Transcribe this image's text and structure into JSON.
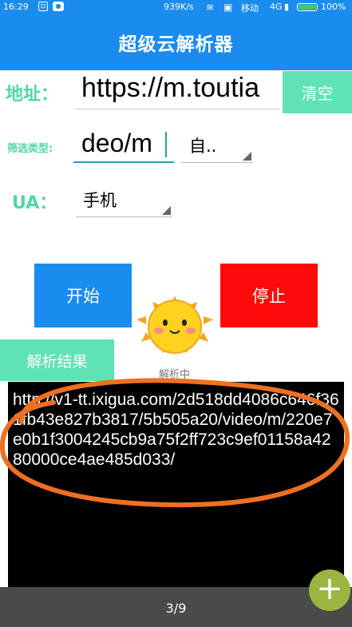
{
  "status_bar": {
    "time": "16:29",
    "net_speed": "939K/s",
    "carrier": "移动",
    "network": "4G",
    "battery": "100%",
    "battery_level": 1.0
  },
  "app": {
    "title": "超级云解析器"
  },
  "form": {
    "address_label": "地址：",
    "url_value": "https://m.toutia",
    "clear_label": "清空",
    "filter_label": "筛选类型:",
    "filter_value": "deo/m",
    "filter_select": "自..",
    "ua_label": "UA：",
    "ua_select": "手机"
  },
  "actions": {
    "start_label": "开始",
    "stop_label": "停止",
    "status_text": "解析中",
    "result_label": "解析结果"
  },
  "result": {
    "text": "http://v1-tt.ixigua.com/2d518dd4086c646f361fb43e827b3817/5b505a20/video/m/220e7e0b1f3004245cb9a75f2ff723c9ef01158a4280000ce4ae485d033/",
    "page_indicator": "3/9"
  },
  "fab": {
    "icon": "plus-icon",
    "label": "+"
  },
  "colors": {
    "primary": "#1a8cf0",
    "accent": "#5fe3b5",
    "stop": "#ff0a0a",
    "annotation": "#f07020",
    "fab": "#9bb540"
  }
}
